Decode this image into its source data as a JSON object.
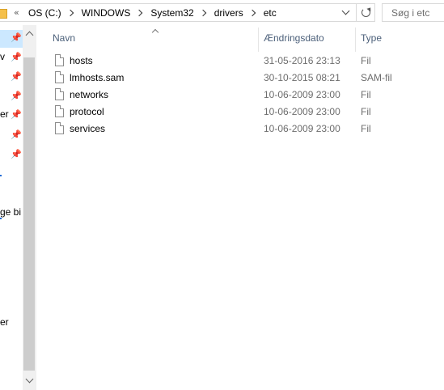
{
  "address_bar": {
    "overflow": "«",
    "breadcrumbs": [
      "OS (C:)",
      "WINDOWS",
      "System32",
      "drivers",
      "etc"
    ],
    "search_placeholder": "Søg i etc"
  },
  "nav_pane": {
    "items": [
      {
        "label": ""
      },
      {
        "label": "v"
      },
      {
        "label": ""
      },
      {
        "label": "er"
      },
      {
        "label": ""
      },
      {
        "label": ""
      },
      {
        "label": "ge bi"
      },
      {
        "label": "er"
      }
    ]
  },
  "file_list": {
    "columns": [
      "Navn",
      "Ændringsdato",
      "Type"
    ],
    "files": [
      {
        "name": "hosts",
        "date": "31-05-2016 23:13",
        "type": "Fil"
      },
      {
        "name": "lmhosts.sam",
        "date": "30-10-2015 08:21",
        "type": "SAM-fil"
      },
      {
        "name": "networks",
        "date": "10-06-2009 23:00",
        "type": "Fil"
      },
      {
        "name": "protocol",
        "date": "10-06-2009 23:00",
        "type": "Fil"
      },
      {
        "name": "services",
        "date": "10-06-2009 23:00",
        "type": "Fil"
      }
    ]
  },
  "colors": {
    "selection": "#cce8ff",
    "header_text": "#4c607a",
    "detail_text": "#6d6d6d",
    "folder": "#f5c04a"
  }
}
